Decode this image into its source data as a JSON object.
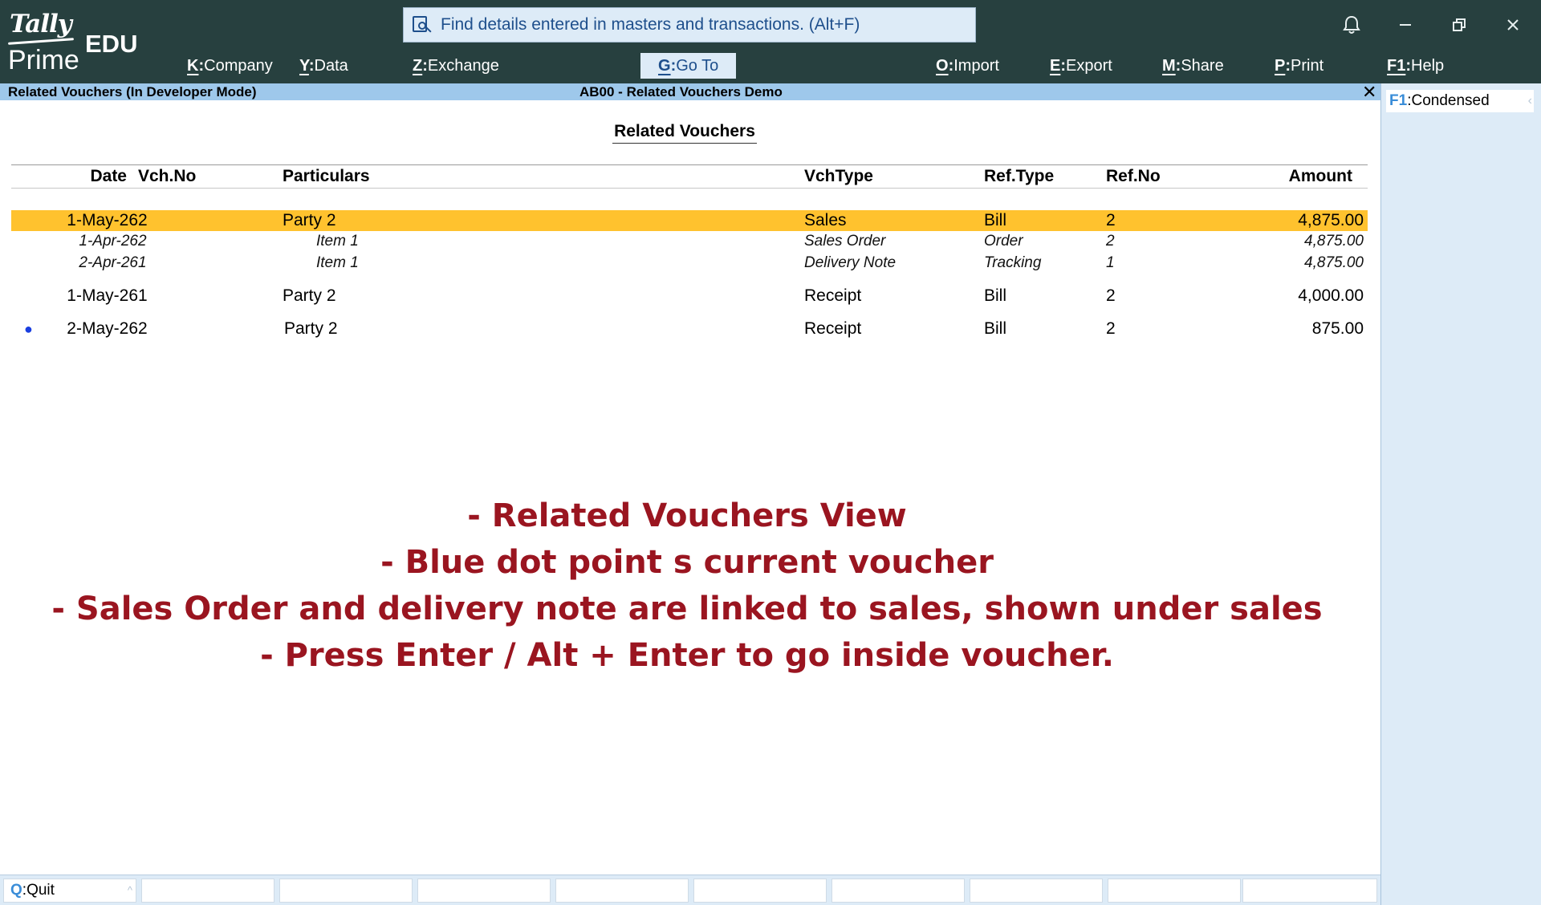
{
  "app": {
    "logo_tally": "Tally",
    "logo_prime": "Prime",
    "logo_edu": "EDU",
    "search_placeholder": "Find details entered in masters and transactions. (Alt+F)"
  },
  "menu": [
    {
      "key": "K",
      "label": "Company"
    },
    {
      "key": "Y",
      "label": "Data"
    },
    {
      "key": "Z",
      "label": "Exchange"
    },
    {
      "key": "G",
      "label": "Go To"
    },
    {
      "key": "O",
      "label": "Import"
    },
    {
      "key": "E",
      "label": "Export"
    },
    {
      "key": "M",
      "label": "Share"
    },
    {
      "key": "P",
      "label": "Print"
    },
    {
      "key": "F1",
      "label": "Help"
    }
  ],
  "titlebar": {
    "left": "Related Vouchers (In Developer Mode)",
    "center": "AB00 - Related Vouchers Demo"
  },
  "right_panel": {
    "key": "F1",
    "label": "Condensed"
  },
  "report": {
    "title": "Related Vouchers",
    "columns": {
      "date": "Date",
      "vch_no": "Vch.No",
      "particulars": "Particulars",
      "vch_type": "VchType",
      "ref_type": "Ref.Type",
      "ref_no": "Ref.No",
      "amount": "Amount"
    },
    "rows": [
      {
        "date": "1-May-26",
        "vch_no": "2",
        "particulars": "Party 2",
        "vch_type": "Sales",
        "ref_type": "Bill",
        "ref_no": "2",
        "amount": "4,875.00",
        "selected": true
      },
      {
        "date": "1-Apr-26",
        "vch_no": "2",
        "particulars": "Item 1",
        "vch_type": "Sales Order",
        "ref_type": "Order",
        "ref_no": "2",
        "amount": "4,875.00",
        "sub": true
      },
      {
        "date": "2-Apr-26",
        "vch_no": "1",
        "particulars": "Item 1",
        "vch_type": "Delivery Note",
        "ref_type": "Tracking",
        "ref_no": "1",
        "amount": "4,875.00",
        "sub": true
      },
      {
        "date": "1-May-26",
        "vch_no": "1",
        "particulars": "Party 2",
        "vch_type": "Receipt",
        "ref_type": "Bill",
        "ref_no": "2",
        "amount": "4,000.00"
      },
      {
        "date": "2-May-26",
        "vch_no": "2",
        "particulars": "Party 2",
        "vch_type": "Receipt",
        "ref_type": "Bill",
        "ref_no": "2",
        "amount": "875.00",
        "current": true,
        "marker": "●"
      }
    ]
  },
  "annotation": [
    "- Related Vouchers View",
    "- Blue dot point s current voucher",
    "- Sales Order and delivery note are linked to sales, shown under sales",
    "- Press Enter / Alt + Enter to go inside voucher."
  ],
  "bottom": {
    "quit_key": "Q",
    "quit_label": "Quit"
  },
  "colors": {
    "topbar": "#27403f",
    "titlebar": "#9ec8eb",
    "selected_row": "#ffc22e",
    "annotation": "#9a1520",
    "current_marker": "#1a3fe0"
  }
}
